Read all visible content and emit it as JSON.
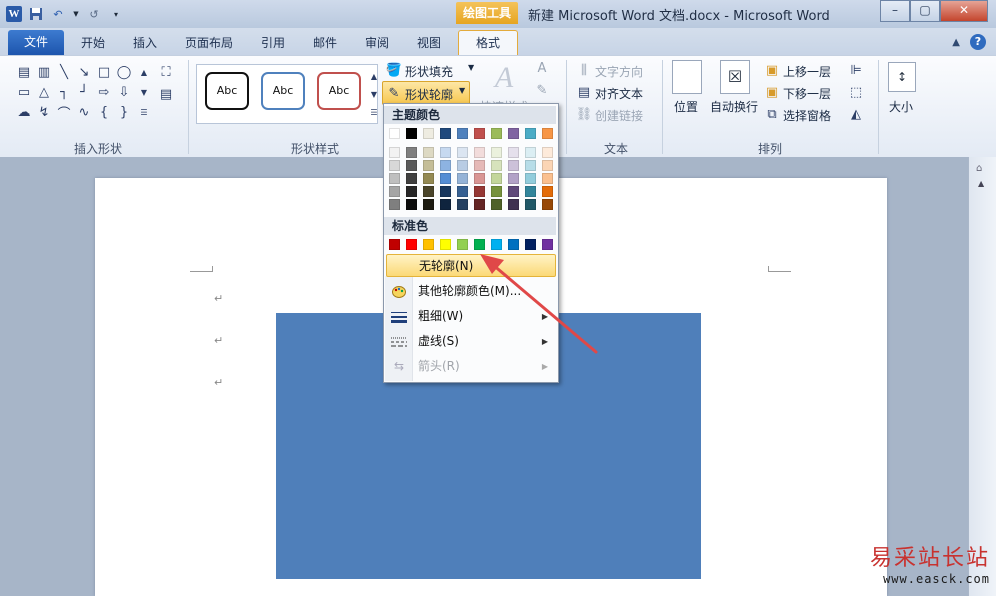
{
  "title_bar": {
    "contextual_group": "绘图工具",
    "window_title": "新建 Microsoft Word 文档.docx - Microsoft Word",
    "word_logo": "W"
  },
  "tabs": [
    {
      "label": "文件"
    },
    {
      "label": "开始"
    },
    {
      "label": "插入"
    },
    {
      "label": "页面布局"
    },
    {
      "label": "引用"
    },
    {
      "label": "邮件"
    },
    {
      "label": "审阅"
    },
    {
      "label": "视图"
    },
    {
      "label": "格式"
    }
  ],
  "ribbon": {
    "groups": {
      "insert_shapes": "插入形状",
      "shape_styles": "形状样式",
      "text": "文本",
      "arrange": "排列"
    },
    "style_gallery": [
      "Abc",
      "Abc",
      "Abc"
    ],
    "shape_fill": "形状填充",
    "shape_outline": "形状轮廓",
    "wordart_partial": "快速样式",
    "text_direction": "文字方向",
    "align_text": "对齐文本",
    "create_link": "创建链接",
    "position": "位置",
    "wrap_text": "自动换行",
    "bring_forward": "上移一层",
    "send_backward": "下移一层",
    "selection_pane": "选择窗格",
    "size": "大小"
  },
  "outline_menu": {
    "theme_colors_heading": "主题颜色",
    "standard_colors_heading": "标准色",
    "theme_top_row": [
      "#ffffff",
      "#000000",
      "#eeece1",
      "#1f497d",
      "#4f81bd",
      "#c0504d",
      "#9bbb59",
      "#8064a2",
      "#4bacc6",
      "#f79646"
    ],
    "theme_shades": [
      [
        "#f2f2f2",
        "#7f7f7f",
        "#ddd9c3",
        "#c6d9f0",
        "#dbe5f1",
        "#f2dcdb",
        "#ebf1dd",
        "#e5e0ec",
        "#dbeef3",
        "#fdeada"
      ],
      [
        "#d8d8d8",
        "#595959",
        "#c4bd97",
        "#8db3e2",
        "#b8cce4",
        "#e5b9b7",
        "#d7e3bc",
        "#ccc1d9",
        "#b7dde8",
        "#fbd5b5"
      ],
      [
        "#bfbfbf",
        "#3f3f3f",
        "#938953",
        "#548dd4",
        "#95b3d7",
        "#d99694",
        "#c3d69b",
        "#b2a2c7",
        "#92cddc",
        "#fac08f"
      ],
      [
        "#a5a5a5",
        "#262626",
        "#494429",
        "#17365d",
        "#366092",
        "#953734",
        "#76923c",
        "#5f497a",
        "#31859b",
        "#e36c09"
      ],
      [
        "#7f7f7f",
        "#0c0c0c",
        "#1d1b10",
        "#0f243e",
        "#244061",
        "#632423",
        "#4f6128",
        "#3f3151",
        "#205867",
        "#974806"
      ]
    ],
    "standard_colors": [
      "#c00000",
      "#ff0000",
      "#ffc000",
      "#ffff00",
      "#92d050",
      "#00b050",
      "#00b0f0",
      "#0070c0",
      "#002060",
      "#7030a0"
    ],
    "items": {
      "no_outline": "无轮廓(N)",
      "more_colors": "其他轮廓颜色(M)...",
      "weight": "粗细(W)",
      "dashes": "虚线(S)",
      "arrows": "箭头(R)"
    }
  },
  "document": {
    "shape_fill_color": "#4f7fba"
  },
  "watermark": {
    "line1": "易采站长站",
    "line2": "www.easck.com"
  }
}
